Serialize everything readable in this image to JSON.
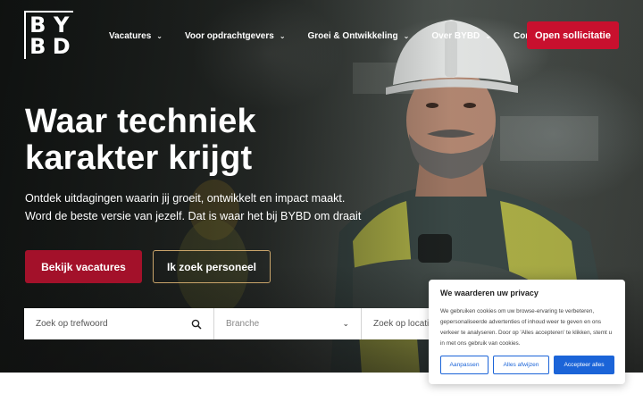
{
  "logo": {
    "letters": [
      "B",
      "Y",
      "B",
      "D"
    ]
  },
  "nav": {
    "items": [
      {
        "label": "Vacatures",
        "has_dropdown": true
      },
      {
        "label": "Voor opdrachtgevers",
        "has_dropdown": true
      },
      {
        "label": "Groei & Ontwikkeling",
        "has_dropdown": true
      },
      {
        "label": "Over BYBD",
        "has_dropdown": true
      },
      {
        "label": "Contact",
        "has_dropdown": false
      }
    ],
    "cta_label": "Open sollicitatie",
    "dropdown_icon": "chevron-down-icon"
  },
  "hero": {
    "title": "Waar techniek karakter krijgt",
    "subtitle": "Ontdek uitdagingen waarin jij groeit, ontwikkelt en impact maakt. Word de beste versie van jezelf. Dat is waar het bij BYBD om draait",
    "primary_button": "Bekijk vacatures",
    "secondary_button": "Ik zoek personeel"
  },
  "search": {
    "keyword_placeholder": "Zoek op trefwoord",
    "branche_placeholder": "Branche",
    "location_placeholder": "Zoek op locatie",
    "search_icon": "search-icon"
  },
  "cookie": {
    "title": "We waarderen uw privacy",
    "text": "We gebruiken cookies om uw browse-ervaring te verbeteren, gepersonaliseerde advertenties of inhoud weer te geven en ons verkeer te analyseren. Door op 'Alles accepteren' te klikken, stemt u in met ons gebruik van cookies.",
    "customize_label": "Aanpassen",
    "reject_label": "Alles afwijzen",
    "accept_label": "Accepteer alles"
  },
  "colors": {
    "brand_red": "#c8102e",
    "primary_button": "#a3112a",
    "outline_gold": "#c9a46a",
    "cookie_blue": "#1b64d8"
  }
}
